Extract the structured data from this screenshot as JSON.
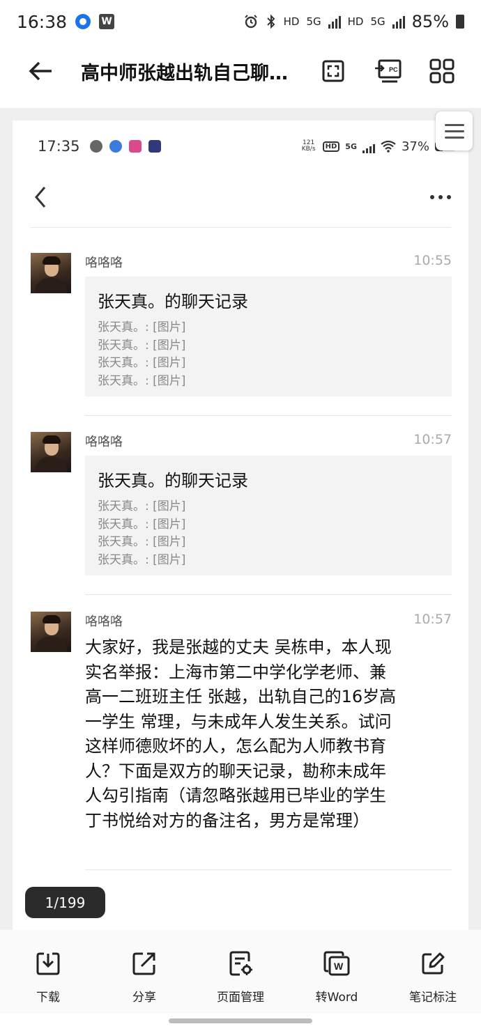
{
  "status_bar": {
    "time": "16:38",
    "battery": "85%",
    "network_labels": [
      "HD",
      "5G",
      "HD",
      "5G"
    ]
  },
  "header": {
    "title": "高中师张越出轨自己聊…",
    "icons": [
      "back-arrow-icon",
      "fullscreen-icon",
      "to-pc-icon",
      "grid-apps-icon"
    ]
  },
  "document": {
    "inner_status": {
      "time": "17:35",
      "rate": "121 KB/s",
      "hd": "HD",
      "network": "5G",
      "battery": "37%"
    },
    "messages": [
      {
        "sender": "咯咯咯",
        "time": "10:55",
        "card_title": "张天真。的聊天记录",
        "lines": [
          "张天真。: [图片]",
          "张天真。: [图片]",
          "张天真。: [图片]",
          "张天真。: [图片]"
        ]
      },
      {
        "sender": "咯咯咯",
        "time": "10:57",
        "card_title": "张天真。的聊天记录",
        "lines": [
          "张天真。: [图片]",
          "张天真。: [图片]",
          "张天真。: [图片]",
          "张天真。: [图片]"
        ]
      },
      {
        "sender": "咯咯咯",
        "time": "10:57",
        "text_lines": [
          "大家好，我是张越的丈夫 吴栋申，本人现",
          "实名举报：上海市第二中学化学老师、兼",
          "高一二班班主任 张越，出轨自己的16岁高",
          "一学生 常理，与未成年人发生关系。试问",
          "这样师德败坏的人，怎么配为人师教书育",
          "人？下面是双方的聊天记录，勘称未成年",
          "人勾引指南（请忽略张越用已毕业的学生",
          "丁书悦给对方的备注名，男方是常理）"
        ]
      }
    ],
    "page_counter": "1/199"
  },
  "toolbar": {
    "items": [
      {
        "label": "下载",
        "icon": "download-icon"
      },
      {
        "label": "分享",
        "icon": "share-icon"
      },
      {
        "label": "页面管理",
        "icon": "page-manage-icon"
      },
      {
        "label": "转Word",
        "icon": "to-word-icon"
      },
      {
        "label": "笔记标注",
        "icon": "note-annotate-icon"
      }
    ]
  }
}
